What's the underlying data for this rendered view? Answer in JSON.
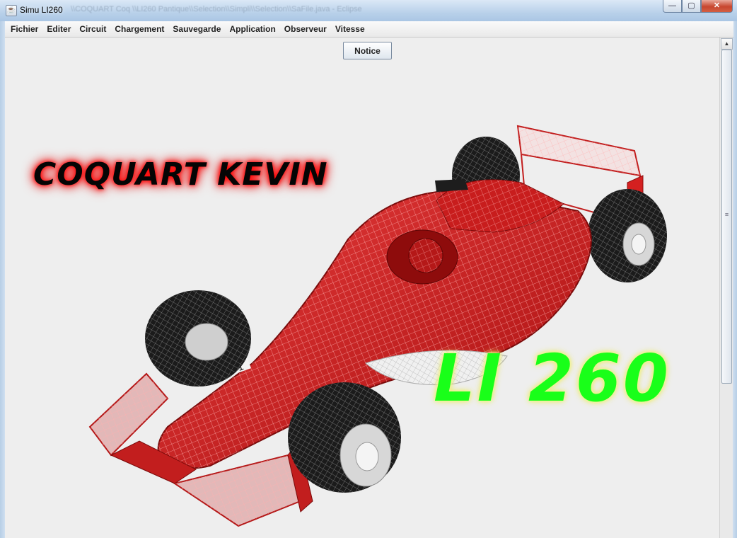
{
  "window": {
    "title": "Simu LI260",
    "title_background_text": "\\\\COQUART Coq \\\\LI260 Pantique\\\\Selection\\\\Simpli\\\\Selection\\\\SaFile.java - Eclipse",
    "controls": {
      "minimize": "—",
      "maximize": "▢",
      "close": "✕"
    }
  },
  "menubar": {
    "items": [
      "Fichier",
      "Editer",
      "Circuit",
      "Chargement",
      "Sauvegarde",
      "Application",
      "Observeur",
      "Vitesse"
    ]
  },
  "content": {
    "notice_button": "Notice",
    "author_name": "COQUART KEVIN",
    "course_title": "LI 260",
    "image": {
      "subject": "Formula 1 car wireframe render",
      "icon": "car-illustration"
    }
  },
  "scrollbar": {
    "up_arrow": "▲",
    "grip": "≡"
  },
  "colors": {
    "name_glow": "#ff0000",
    "title_fill": "#19ff19",
    "title_glow": "#f1f17a",
    "car_body": "#d42020",
    "tyres": "#1a1a1a"
  }
}
